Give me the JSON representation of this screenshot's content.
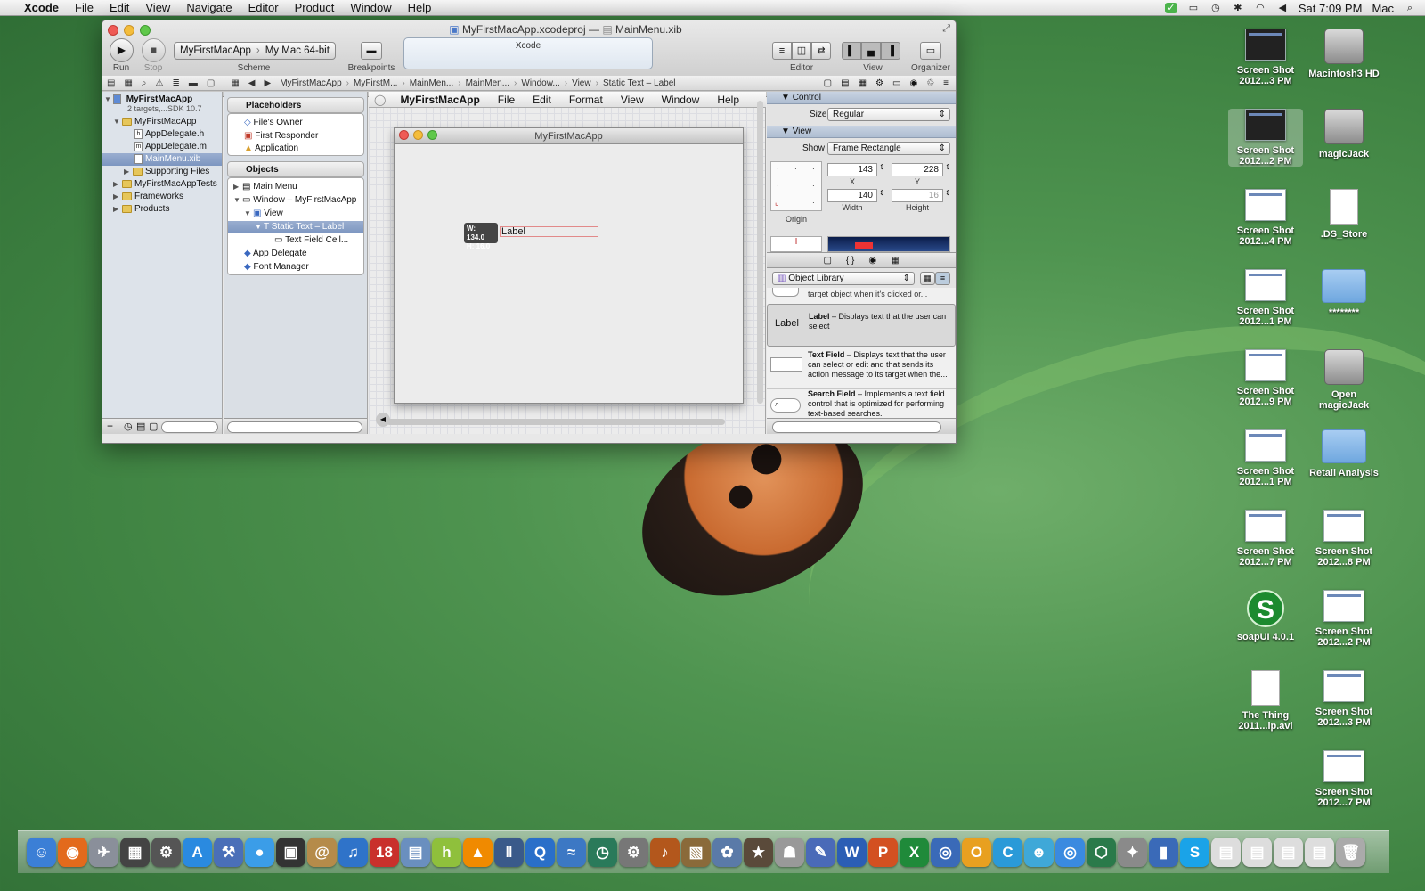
{
  "menubar": {
    "apple": "",
    "app": "Xcode",
    "items": [
      "File",
      "Edit",
      "View",
      "Navigate",
      "Editor",
      "Product",
      "Window",
      "Help"
    ],
    "clock": "Sat 7:09 PM",
    "user": "Mac"
  },
  "window": {
    "title": "MyFirstMacApp.xcodeproj",
    "title_sep": "—",
    "title_file": "MainMenu.xib",
    "toolbar": {
      "run": "Run",
      "stop": "Stop",
      "scheme_app": "MyFirstMacApp",
      "scheme_dest": "My Mac 64-bit",
      "scheme_label": "Scheme",
      "breakpoints": "Breakpoints",
      "activity": "Xcode",
      "editor": "Editor",
      "view": "View",
      "organizer": "Organizer"
    },
    "jumpbar": [
      "MyFirstMacApp",
      "MyFirstM...",
      "MainMen...",
      "MainMen...",
      "Window...",
      "View",
      "Static Text – Label"
    ],
    "navigator": {
      "project": "MyFirstMacApp",
      "project_sub": "2 targets,...SDK 10.7",
      "items": [
        {
          "label": "MyFirstMacApp",
          "kind": "folder"
        },
        {
          "label": "AppDelegate.h",
          "kind": "h"
        },
        {
          "label": "AppDelegate.m",
          "kind": "m"
        },
        {
          "label": "MainMenu.xib",
          "kind": "xib"
        },
        {
          "label": "Supporting Files",
          "kind": "folder"
        },
        {
          "label": "MyFirstMacAppTests",
          "kind": "folder"
        },
        {
          "label": "Frameworks",
          "kind": "folder"
        },
        {
          "label": "Products",
          "kind": "folder"
        }
      ]
    },
    "outline": {
      "placeholders_title": "Placeholders",
      "placeholders": [
        "File's Owner",
        "First Responder",
        "Application"
      ],
      "objects_title": "Objects",
      "objects": [
        "Main Menu",
        "Window – MyFirstMacApp",
        "View",
        "Static Text – Label",
        "Text Field Cell...",
        "App Delegate",
        "Font Manager"
      ]
    },
    "design": {
      "menu": [
        "MyFirstMacApp",
        "File",
        "Edit",
        "Format",
        "View",
        "Window",
        "Help"
      ],
      "window_title": "MyFirstMacApp",
      "label_text": "Label",
      "size_w": "W: 134.0",
      "size_h": "H:   16.0"
    },
    "inspector": {
      "control_header": "Control",
      "size_label": "Size",
      "size_value": "Regular",
      "view_header": "View",
      "show_label": "Show",
      "show_value": "Frame Rectangle",
      "x": "143",
      "y": "228",
      "width": "140",
      "height": "16",
      "x_cap": "X",
      "y_cap": "Y",
      "w_cap": "Width",
      "h_cap": "Height",
      "origin_cap": "Origin",
      "library_popup": "Object Library",
      "lib_partial": "target object when it's clicked or...",
      "lib": [
        {
          "name": "Label",
          "desc": "Displays text that the user can select",
          "icon": "Label"
        },
        {
          "name": "Text Field",
          "desc": "Displays text that the user can select or edit and that sends its action message to its target when the...",
          "icon": ""
        },
        {
          "name": "Search Field",
          "desc": "Implements a text field control that is optimized for performing text-based searches.",
          "icon": "⌕"
        }
      ]
    }
  },
  "desktop": {
    "icons": [
      {
        "label": "Screen Shot 2012...3 PM",
        "kind": "shot-dark"
      },
      {
        "label": "Macintosh3 HD",
        "kind": "hd"
      },
      {
        "label": "Screen Shot 2012...2 PM",
        "kind": "shot-dark-sel"
      },
      {
        "label": "magicJack",
        "kind": "hd"
      },
      {
        "label": "Screen Shot 2012...4 PM",
        "kind": "shot"
      },
      {
        "label": ".DS_Store",
        "kind": "doc"
      },
      {
        "label": "Screen Shot 2012...1 PM",
        "kind": "shot"
      },
      {
        "label": "********",
        "kind": "folder"
      },
      {
        "label": "Screen Shot 2012...9 PM",
        "kind": "shot"
      },
      {
        "label": "Open magicJack",
        "kind": "hd"
      },
      {
        "label": "Screen Shot 2012...1 PM",
        "kind": "shot"
      },
      {
        "label": "Retail Analysis",
        "kind": "folder"
      },
      {
        "label": "Screen Shot 2012...7 PM",
        "kind": "shot"
      },
      {
        "label": "Screen Shot 2012...8 PM",
        "kind": "shot"
      },
      {
        "label": "soapUI 4.0.1",
        "kind": "soap"
      },
      {
        "label": "Screen Shot 2012...2 PM",
        "kind": "shot"
      },
      {
        "label": "The Thing 2011...ip.avi",
        "kind": "doc"
      },
      {
        "label": "Screen Shot 2012...3 PM",
        "kind": "shot"
      },
      {
        "label": "Screen Shot 2012...7 PM",
        "kind": "shot"
      }
    ]
  },
  "dock": [
    {
      "name": "finder",
      "glyph": "☺",
      "color": "#3b7fd6"
    },
    {
      "name": "firefox",
      "glyph": "◉",
      "color": "#e36a1c"
    },
    {
      "name": "launchpad",
      "glyph": "✈",
      "color": "#8a8f9a"
    },
    {
      "name": "dashboard",
      "glyph": "▦",
      "color": "#444"
    },
    {
      "name": "system-prefs",
      "glyph": "⚙",
      "color": "#555"
    },
    {
      "name": "app-store",
      "glyph": "A",
      "color": "#2a8ae0"
    },
    {
      "name": "xcode",
      "glyph": "⚒",
      "color": "#4a6fb8"
    },
    {
      "name": "ichat",
      "glyph": "●",
      "color": "#3b9de8"
    },
    {
      "name": "facetime",
      "glyph": "▣",
      "color": "#333"
    },
    {
      "name": "address-book",
      "glyph": "@",
      "color": "#b58b4a"
    },
    {
      "name": "itunes",
      "glyph": "♫",
      "color": "#2f73c9"
    },
    {
      "name": "ical",
      "glyph": "18",
      "color": "#c9302c"
    },
    {
      "name": "preview",
      "glyph": "▤",
      "color": "#6a8fbf"
    },
    {
      "name": "h-app",
      "glyph": "h",
      "color": "#8fc03c"
    },
    {
      "name": "vlc",
      "glyph": "▲",
      "color": "#f08a00"
    },
    {
      "name": "pause",
      "glyph": "‖",
      "color": "#3a5a8a"
    },
    {
      "name": "quicktime",
      "glyph": "Q",
      "color": "#2a6fc9"
    },
    {
      "name": "migration",
      "glyph": "≈",
      "color": "#3c78c4"
    },
    {
      "name": "time-machine",
      "glyph": "◷",
      "color": "#2a7a5a"
    },
    {
      "name": "utility",
      "glyph": "⚙",
      "color": "#777"
    },
    {
      "name": "guitar",
      "glyph": "♪",
      "color": "#b3571c"
    },
    {
      "name": "photo",
      "glyph": "▧",
      "color": "#8a6a3a"
    },
    {
      "name": "iphoto",
      "glyph": "✿",
      "color": "#5a7aa8"
    },
    {
      "name": "imovie",
      "glyph": "★",
      "color": "#5a4a3a"
    },
    {
      "name": "robot",
      "glyph": "☗",
      "color": "#999"
    },
    {
      "name": "tool",
      "glyph": "✎",
      "color": "#4a6ab8"
    },
    {
      "name": "word",
      "glyph": "W",
      "color": "#2b5eb5"
    },
    {
      "name": "powerpoint",
      "glyph": "P",
      "color": "#d35021"
    },
    {
      "name": "excel",
      "glyph": "X",
      "color": "#1f8a3a"
    },
    {
      "name": "media",
      "glyph": "◎",
      "color": "#3a6ab8"
    },
    {
      "name": "outlook",
      "glyph": "O",
      "color": "#e8a020"
    },
    {
      "name": "c-app",
      "glyph": "C",
      "color": "#2a9ad8"
    },
    {
      "name": "messenger",
      "glyph": "☻",
      "color": "#3fa8d8"
    },
    {
      "name": "safari",
      "glyph": "◎",
      "color": "#3a8ae0"
    },
    {
      "name": "network",
      "glyph": "⬡",
      "color": "#2a7a4a"
    },
    {
      "name": "satellite",
      "glyph": "✦",
      "color": "#8a8a8a"
    },
    {
      "name": "notebook",
      "glyph": "▮",
      "color": "#3a6ab8"
    },
    {
      "name": "skype",
      "glyph": "S",
      "color": "#1aa3e8"
    },
    {
      "name": "doc-1",
      "glyph": "▤",
      "color": "#ddd"
    },
    {
      "name": "doc-2",
      "glyph": "▤",
      "color": "#ddd"
    },
    {
      "name": "doc-3",
      "glyph": "▤",
      "color": "#ddd"
    },
    {
      "name": "doc-4",
      "glyph": "▤",
      "color": "#ddd"
    },
    {
      "name": "trash",
      "glyph": "🗑",
      "color": "#aaa"
    }
  ]
}
